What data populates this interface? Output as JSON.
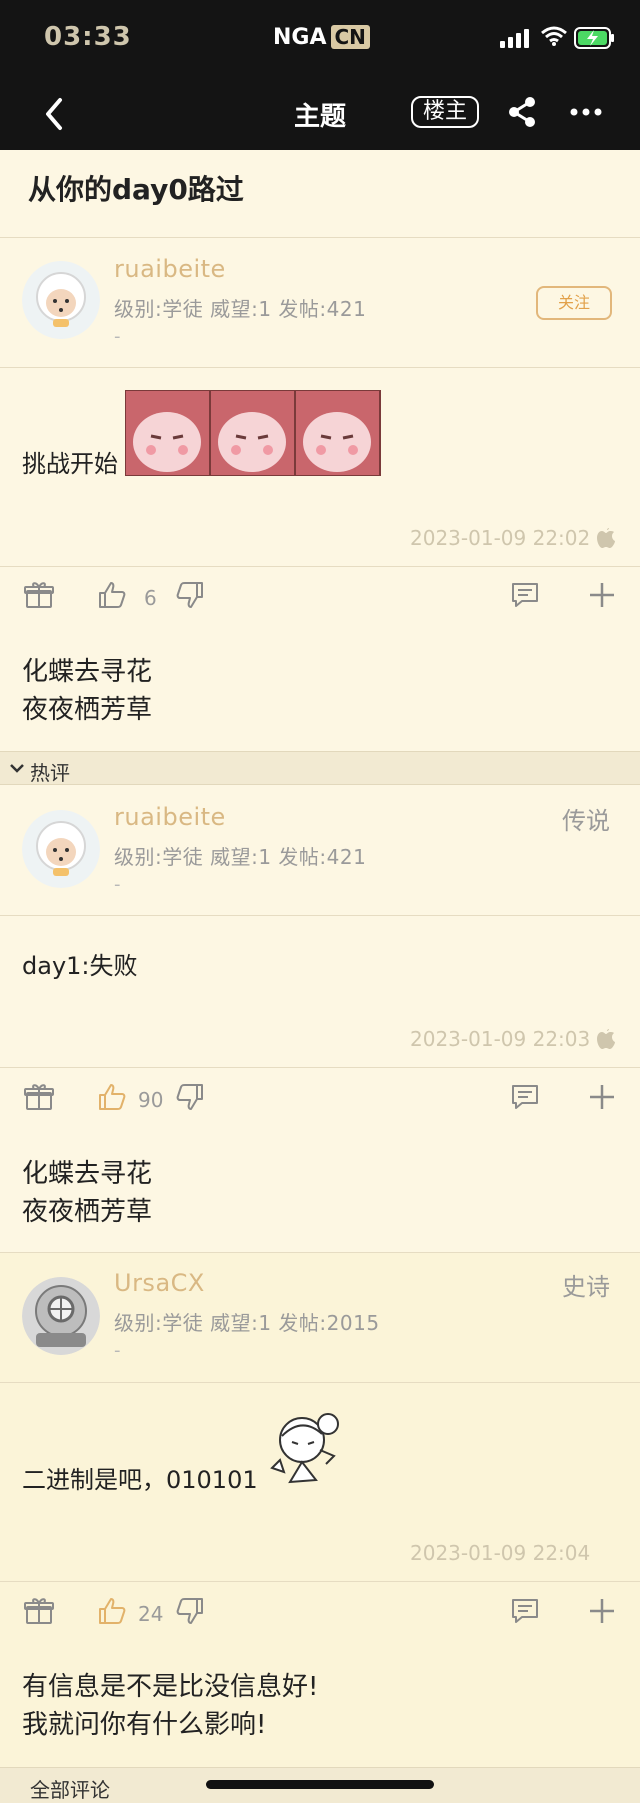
{
  "status_bar": {
    "time": "03:33",
    "app_logo": "NGA",
    "app_logo_suffix": "CN"
  },
  "nav": {
    "title": "主题",
    "owner_label": "楼主"
  },
  "thread": {
    "title": "从你的day0路过"
  },
  "posts": [
    {
      "username": "ruaibeite",
      "meta": "级别:学徒   威望:1   发帖:421",
      "dash": "-",
      "follow_label": "关注",
      "content": "挑战开始",
      "timestamp": "2023-01-09 22:02",
      "likes": "6",
      "signature": [
        "化蝶去寻花",
        "夜夜栖芳草"
      ]
    },
    {
      "username": "ruaibeite",
      "meta": "级别:学徒   威望:1   发帖:421",
      "dash": "-",
      "rank": "传说",
      "content": "day1:失败",
      "timestamp": "2023-01-09 22:03",
      "likes": "90",
      "signature": [
        "化蝶去寻花",
        "夜夜栖芳草"
      ]
    },
    {
      "username": "UrsaCX",
      "meta": "级别:学徒   威望:1   发帖:2015",
      "dash": "-",
      "rank": "史诗",
      "content": "二进制是吧，010101",
      "timestamp": "2023-01-09 22:04",
      "likes": "24",
      "signature": [
        "有信息是不是比没信息好!",
        "我就问你有什么影响!"
      ]
    }
  ],
  "sections": {
    "hot": "热评",
    "all": "全部评论"
  },
  "colors": {
    "accent": "#d9b883",
    "background": "#fdf7e3",
    "liked": "#e2b26a"
  }
}
